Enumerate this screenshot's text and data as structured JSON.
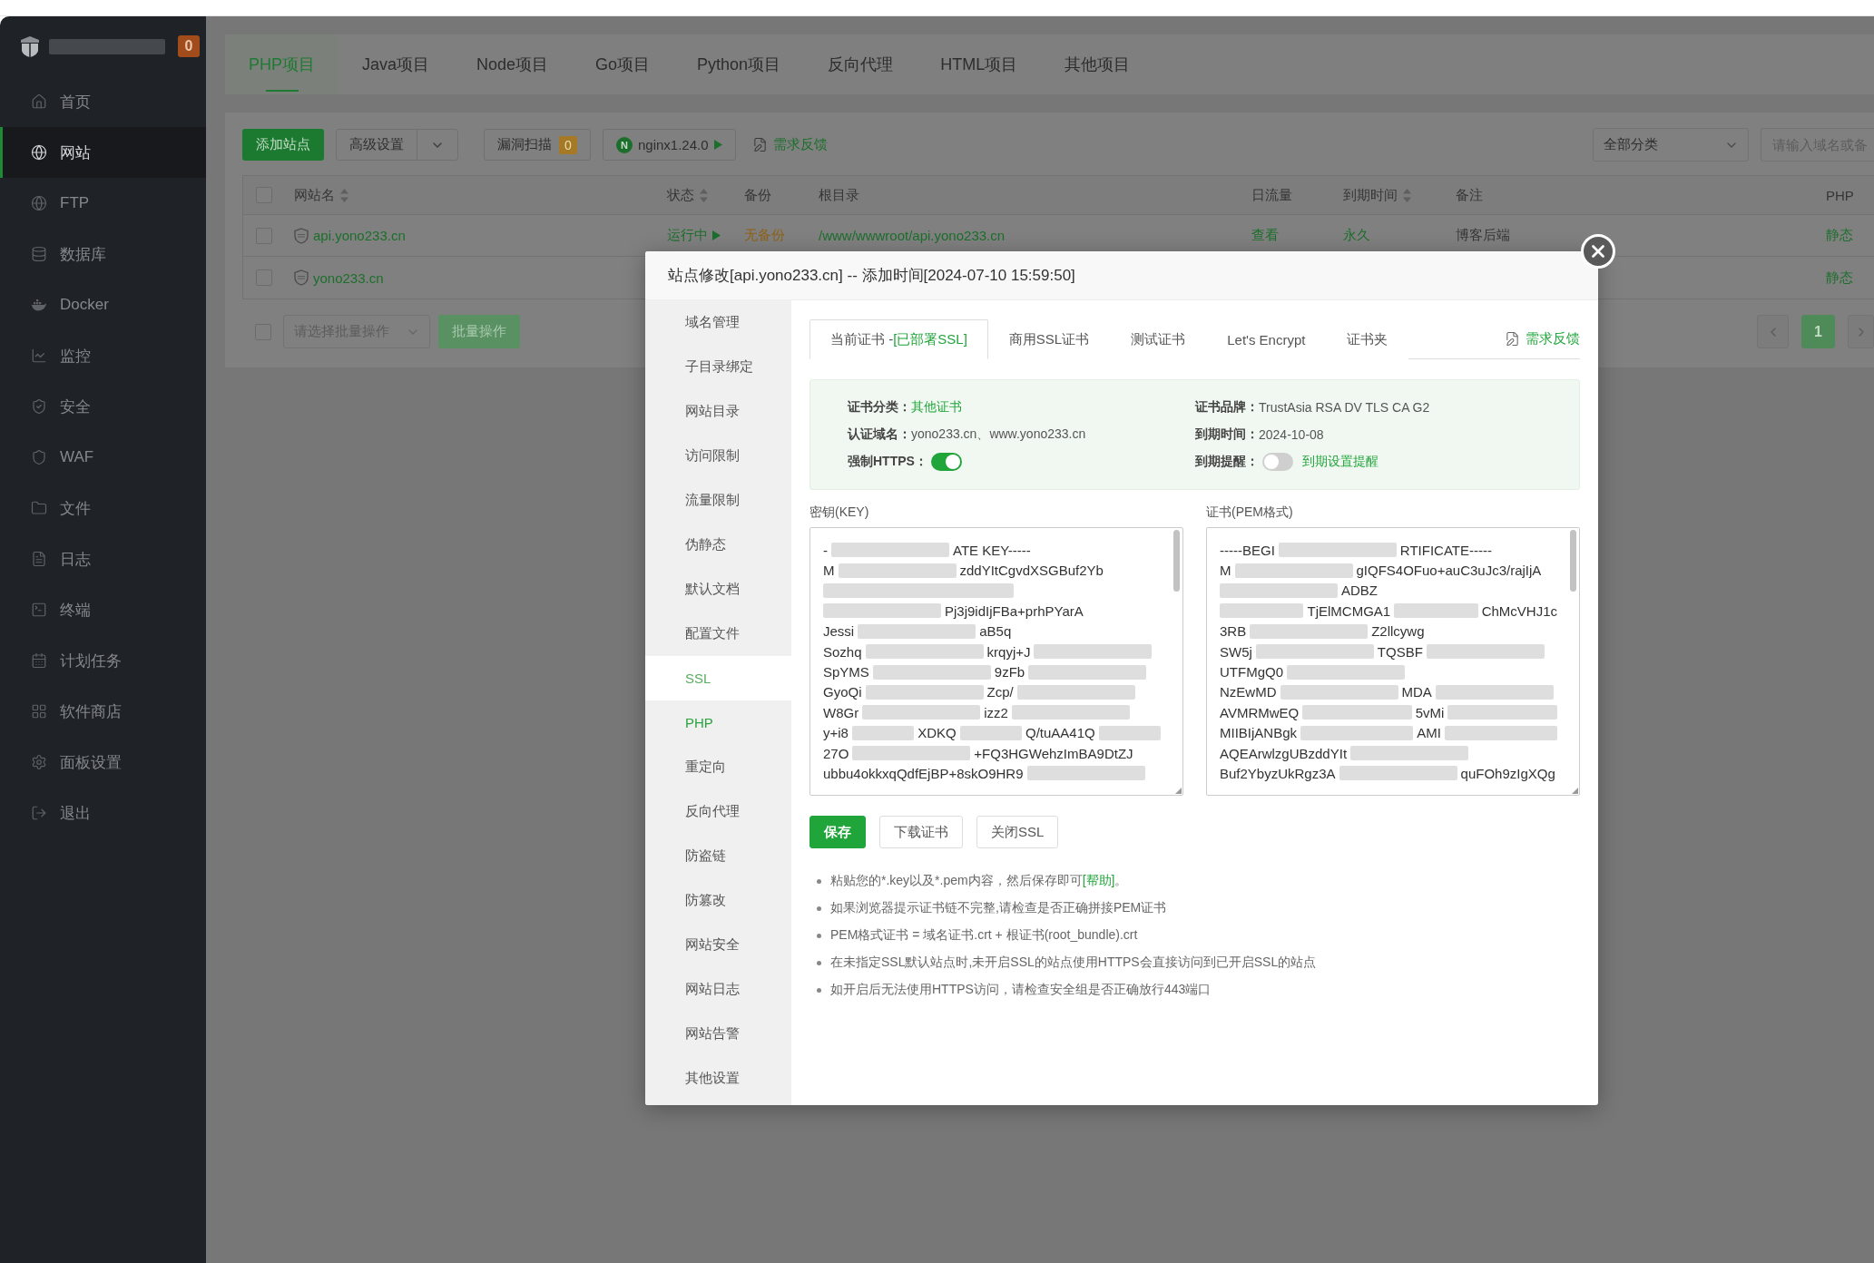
{
  "sidebar": {
    "badge": "0",
    "items": [
      {
        "label": "首页",
        "selected": false
      },
      {
        "label": "网站",
        "selected": true
      },
      {
        "label": "FTP",
        "selected": false
      },
      {
        "label": "数据库",
        "selected": false
      },
      {
        "label": "Docker",
        "selected": false
      },
      {
        "label": "监控",
        "selected": false
      },
      {
        "label": "安全",
        "selected": false
      },
      {
        "label": "WAF",
        "selected": false
      },
      {
        "label": "文件",
        "selected": false
      },
      {
        "label": "日志",
        "selected": false
      },
      {
        "label": "终端",
        "selected": false
      },
      {
        "label": "计划任务",
        "selected": false
      },
      {
        "label": "软件商店",
        "selected": false
      },
      {
        "label": "面板设置",
        "selected": false
      },
      {
        "label": "退出",
        "selected": false
      }
    ]
  },
  "project_tabs": [
    {
      "label": "PHP项目",
      "selected": true
    },
    {
      "label": "Java项目",
      "selected": false
    },
    {
      "label": "Node项目",
      "selected": false
    },
    {
      "label": "Go项目",
      "selected": false
    },
    {
      "label": "Python项目",
      "selected": false
    },
    {
      "label": "反向代理",
      "selected": false
    },
    {
      "label": "HTML项目",
      "selected": false
    },
    {
      "label": "其他项目",
      "selected": false
    }
  ],
  "toolbar": {
    "add_button": "添加站点",
    "advanced_button": "高级设置",
    "scan_button": {
      "label": "漏洞扫描",
      "count": "0"
    },
    "server_button": {
      "logo": "N",
      "label": "nginx1.24.0"
    },
    "feedback_link": "需求反馈",
    "category_select": "全部分类",
    "search": {
      "placeholder": "请输入域名或备"
    }
  },
  "table": {
    "select_all_checked": false,
    "columns": [
      {
        "label": "网站名",
        "sortable": true
      },
      {
        "label": "状态",
        "sortable": true
      },
      {
        "label": "备份",
        "sortable": false
      },
      {
        "label": "根目录",
        "sortable": false
      },
      {
        "label": "日流量",
        "sortable": false
      },
      {
        "label": "到期时间",
        "sortable": true
      },
      {
        "label": "备注",
        "sortable": false
      },
      {
        "label": "PHP",
        "sortable": false
      }
    ],
    "rows": [
      {
        "checked": false,
        "name": "api.yono233.cn",
        "status": "运行中",
        "backup": "无备份",
        "root": "/www/wwwroot/api.yono233.cn",
        "traffic": "查看",
        "expiry": "永久",
        "note": "博客后端",
        "php": "静态"
      },
      {
        "checked": false,
        "name": "yono233.cn",
        "php": "静态"
      }
    ]
  },
  "batch": {
    "checked": false,
    "placeholder": "请选择批量操作",
    "button": {
      "label": "批量操作",
      "disabled": true
    }
  },
  "pagination": {
    "pages": [
      {
        "label": "1",
        "selected": true
      }
    ]
  },
  "dialog": {
    "title": "站点修改[api.yono233.cn] -- 添加时间[2024-07-10 15:59:50]",
    "nav": [
      {
        "label": "域名管理",
        "selected": false,
        "accent": false
      },
      {
        "label": "子目录绑定",
        "selected": false,
        "accent": false
      },
      {
        "label": "网站目录",
        "selected": false,
        "accent": false
      },
      {
        "label": "访问限制",
        "selected": false,
        "accent": false
      },
      {
        "label": "流量限制",
        "selected": false,
        "accent": false
      },
      {
        "label": "伪静态",
        "selected": false,
        "accent": false
      },
      {
        "label": "默认文档",
        "selected": false,
        "accent": false
      },
      {
        "label": "配置文件",
        "selected": false,
        "accent": false
      },
      {
        "label": "SSL",
        "selected": true,
        "accent": false
      },
      {
        "label": "PHP",
        "selected": false,
        "accent": true
      },
      {
        "label": "重定向",
        "selected": false,
        "accent": false
      },
      {
        "label": "反向代理",
        "selected": false,
        "accent": false
      },
      {
        "label": "防盗链",
        "selected": false,
        "accent": false
      },
      {
        "label": "防篡改",
        "selected": false,
        "accent": false
      },
      {
        "label": "网站安全",
        "selected": false,
        "accent": false
      },
      {
        "label": "网站日志",
        "selected": false,
        "accent": false
      },
      {
        "label": "网站告警",
        "selected": false,
        "accent": false
      },
      {
        "label": "其他设置",
        "selected": false,
        "accent": false
      }
    ],
    "ssl_tabs": [
      {
        "label": "当前证书 -",
        "status": "[已部署SSL]",
        "selected": true
      },
      {
        "label": "商用SSL证书",
        "selected": false
      },
      {
        "label": "测试证书",
        "selected": false
      },
      {
        "label": "Let's Encrypt",
        "selected": false
      },
      {
        "label": "证书夹",
        "selected": false
      }
    ],
    "feedback_link": "需求反馈",
    "cert_info": [
      {
        "label": "证书分类：",
        "kind": "link",
        "value": "其他证书"
      },
      {
        "label": "证书品牌：",
        "kind": "text",
        "value": "TrustAsia RSA DV TLS CA G2"
      },
      {
        "label": "认证域名：",
        "kind": "text",
        "value": "yono233.cn、www.yono233.cn"
      },
      {
        "label": "到期时间：",
        "kind": "text",
        "value": "2024-10-08"
      },
      {
        "label": "强制HTTPS：",
        "kind": "toggle",
        "on": true
      },
      {
        "label": "到期提醒：",
        "kind": "toggle",
        "on": false,
        "link": "到期设置提醒"
      }
    ],
    "key": {
      "label": "密钥(KEY)",
      "lines": [
        [
          {
            "kind": "text",
            "text": "-"
          },
          {
            "kind": "redacted"
          },
          {
            "kind": "text",
            "text": "ATE KEY-----"
          }
        ],
        [
          {
            "kind": "text",
            "text": "M"
          },
          {
            "kind": "redacted"
          },
          {
            "kind": "text",
            "text": "zddYItCgvdXSGBuf2Yb"
          }
        ],
        [
          {
            "kind": "redacted"
          }
        ],
        [
          {
            "kind": "redacted"
          },
          {
            "kind": "text",
            "text": "Pj3j9idIjFBa+prhPYarA"
          }
        ],
        [
          {
            "kind": "text",
            "text": "Jessi"
          },
          {
            "kind": "redacted"
          },
          {
            "kind": "text",
            "text": "aB5q"
          }
        ],
        [
          {
            "kind": "text",
            "text": "Sozhq"
          },
          {
            "kind": "redacted"
          },
          {
            "kind": "text",
            "text": "krqyj+J"
          },
          {
            "kind": "redacted"
          }
        ],
        [
          {
            "kind": "text",
            "text": "SpYMS"
          },
          {
            "kind": "redacted"
          },
          {
            "kind": "text",
            "text": "9zFb"
          },
          {
            "kind": "redacted"
          }
        ],
        [
          {
            "kind": "text",
            "text": "GyoQi"
          },
          {
            "kind": "redacted"
          },
          {
            "kind": "text",
            "text": "Zcp/"
          },
          {
            "kind": "redacted"
          }
        ],
        [
          {
            "kind": "text",
            "text": "W8Gr"
          },
          {
            "kind": "redacted"
          },
          {
            "kind": "text",
            "text": "izz2"
          },
          {
            "kind": "redacted"
          }
        ],
        [
          {
            "kind": "text",
            "text": "y+i8"
          },
          {
            "kind": "redacted"
          },
          {
            "kind": "text",
            "text": "XDKQ"
          },
          {
            "kind": "redacted"
          },
          {
            "kind": "text",
            "text": "Q/tuAA41Q"
          },
          {
            "kind": "redacted"
          }
        ],
        [
          {
            "kind": "text",
            "text": "27O"
          },
          {
            "kind": "redacted"
          },
          {
            "kind": "text",
            "text": "+FQ3HGWehzImBA9DtZJ"
          }
        ],
        [
          {
            "kind": "text",
            "text": "ubbu4okkxqQdfEjBP+8skO9HR9"
          },
          {
            "kind": "redacted"
          }
        ]
      ]
    },
    "cert": {
      "label": "证书(PEM格式)",
      "lines": [
        [
          {
            "kind": "text",
            "text": "-----BEGI"
          },
          {
            "kind": "redacted"
          },
          {
            "kind": "text",
            "text": "RTIFICATE-----"
          }
        ],
        [
          {
            "kind": "text",
            "text": "M"
          },
          {
            "kind": "redacted"
          },
          {
            "kind": "text",
            "text": "gIQFS4OFuo+auC3uJc3/rajIjA"
          }
        ],
        [
          {
            "kind": "redacted"
          },
          {
            "kind": "text",
            "text": "ADBZ"
          }
        ],
        [
          {
            "kind": "redacted"
          },
          {
            "kind": "text",
            "text": "TjElMCMGA1"
          },
          {
            "kind": "redacted"
          },
          {
            "kind": "text",
            "text": "ChMcVHJ1c"
          }
        ],
        [
          {
            "kind": "text",
            "text": "3RB"
          },
          {
            "kind": "redacted"
          },
          {
            "kind": "text",
            "text": "Z2llcywg"
          }
        ],
        [
          {
            "kind": "text",
            "text": "SW5j"
          },
          {
            "kind": "redacted"
          },
          {
            "kind": "text",
            "text": "TQSBF"
          },
          {
            "kind": "redacted"
          }
        ],
        [
          {
            "kind": "text",
            "text": "UTFMgQ0"
          },
          {
            "kind": "redacted"
          }
        ],
        [
          {
            "kind": "text",
            "text": "NzEwMD"
          },
          {
            "kind": "redacted"
          },
          {
            "kind": "text",
            "text": "MDA"
          },
          {
            "kind": "redacted"
          }
        ],
        [
          {
            "kind": "text",
            "text": "AVMRMwEQ"
          },
          {
            "kind": "redacted"
          },
          {
            "kind": "text",
            "text": "5vMi"
          },
          {
            "kind": "redacted"
          }
        ],
        [
          {
            "kind": "text",
            "text": "MIIBIjANBgk"
          },
          {
            "kind": "redacted"
          },
          {
            "kind": "text",
            "text": "AMI"
          },
          {
            "kind": "redacted"
          }
        ],
        [
          {
            "kind": "text",
            "text": "AQEArwlzgUBzddYIt"
          },
          {
            "kind": "redacted"
          }
        ],
        [
          {
            "kind": "text",
            "text": "Buf2YbyzUkRgz3A"
          },
          {
            "kind": "redacted"
          },
          {
            "kind": "text",
            "text": "quFOh9zIgXQg"
          }
        ]
      ]
    },
    "buttons": [
      {
        "label": "保存",
        "kind": "primary"
      },
      {
        "label": "下载证书",
        "kind": "default"
      },
      {
        "label": "关闭SSL",
        "kind": "default"
      }
    ],
    "tips": [
      {
        "text": "粘贴您的*.key以及*.pem内容，然后保存即可",
        "link": "[帮助]",
        "after": "。"
      },
      {
        "text": "如果浏览器提示证书链不完整,请检查是否正确拼接PEM证书"
      },
      {
        "text": "PEM格式证书 = 域名证书.crt + 根证书(root_bundle).crt"
      },
      {
        "text": "在未指定SSL默认站点时,未开启SSL的站点使用HTTPS会直接访问到已开启SSL的站点"
      },
      {
        "text": "如开启后无法使用HTTPS访问，请检查安全组是否正确放行443端口"
      }
    ]
  }
}
